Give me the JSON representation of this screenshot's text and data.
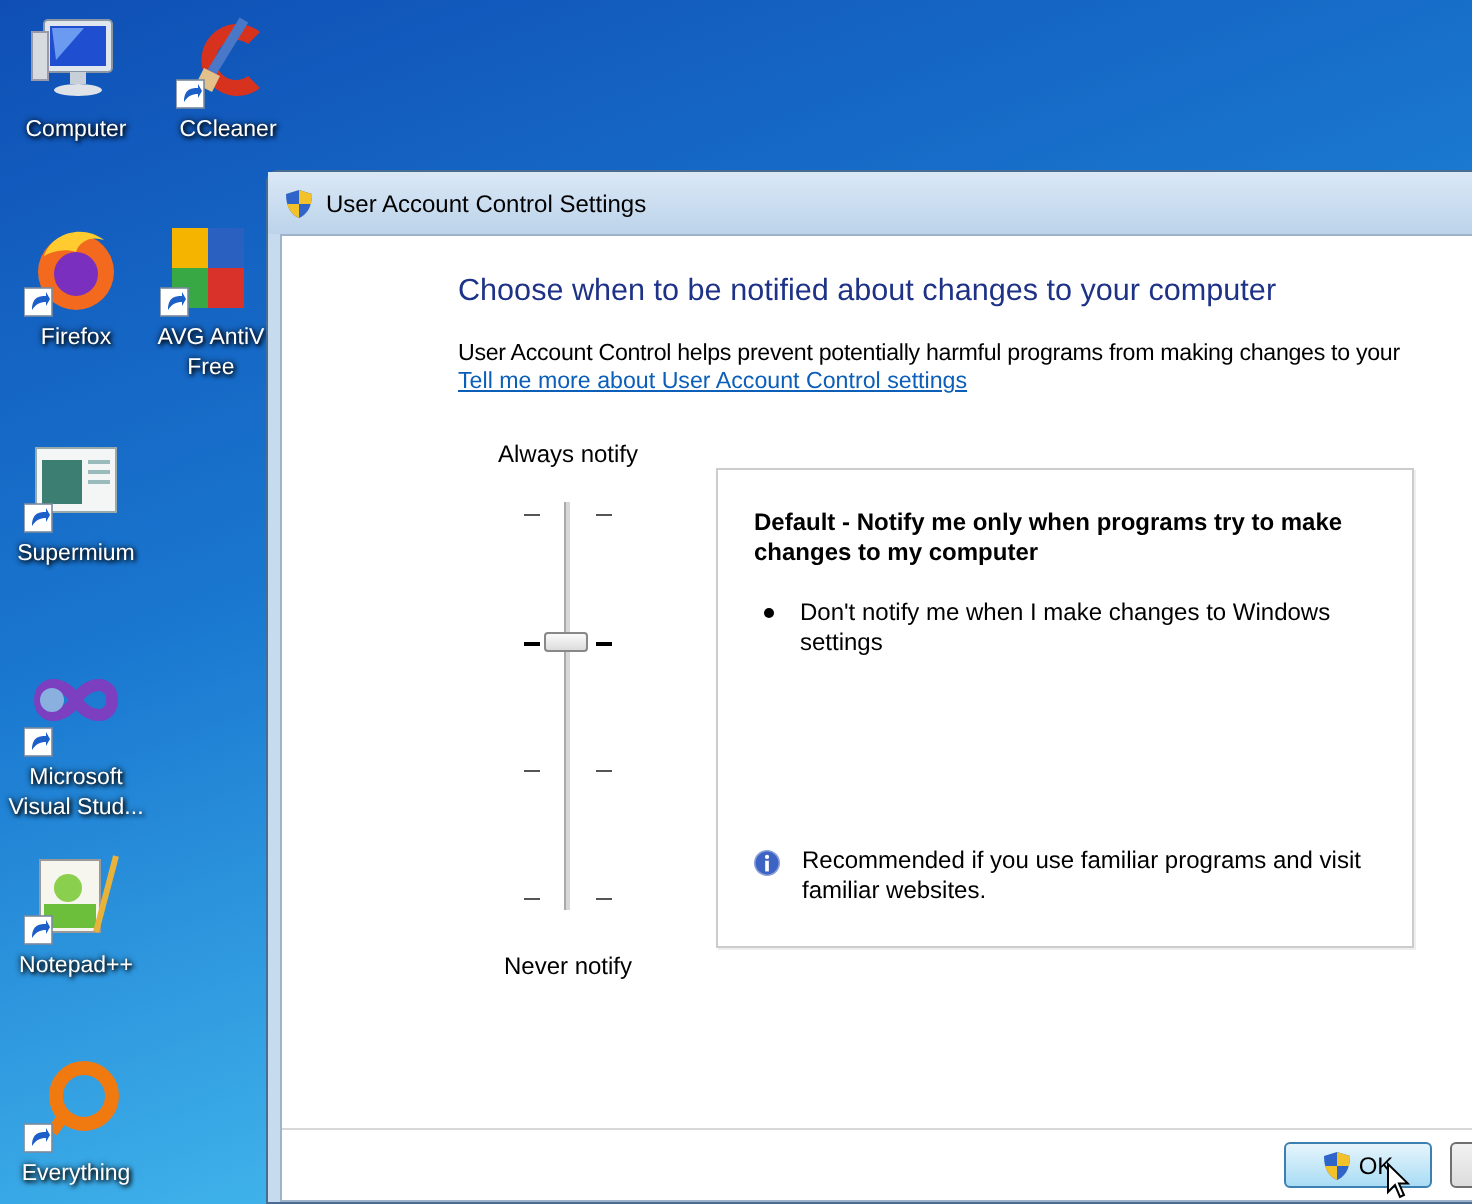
{
  "desktop": {
    "icons": [
      {
        "label": "Computer",
        "kind": "computer"
      },
      {
        "label": "CCleaner",
        "kind": "ccleaner"
      },
      {
        "label": "Firefox",
        "kind": "firefox"
      },
      {
        "label": "AVG AntiV\nFree",
        "kind": "avg"
      },
      {
        "label": "Supermium",
        "kind": "supermium"
      },
      {
        "label": "Microsoft\nVisual Stud...",
        "kind": "visualstudio"
      },
      {
        "label": "Notepad++",
        "kind": "notepad"
      },
      {
        "label": "Everything",
        "kind": "everything"
      }
    ]
  },
  "window": {
    "title": "User Account Control Settings",
    "heading": "Choose when to be notified about changes to your computer",
    "description": "User Account Control helps prevent potentially harmful programs from making changes to your",
    "link": "Tell me more about User Account Control settings",
    "slider": {
      "top_label": "Always notify",
      "bottom_label": "Never notify",
      "level": 0.667
    },
    "details": {
      "title": "Default - Notify me only when programs try to make changes to my computer",
      "bullets": [
        "Don't notify me when I make changes to Windows settings"
      ],
      "note": "Recommended if you use familiar programs and visit familiar websites."
    },
    "buttons": [
      {
        "label": "OK",
        "kind": "ok"
      }
    ]
  }
}
